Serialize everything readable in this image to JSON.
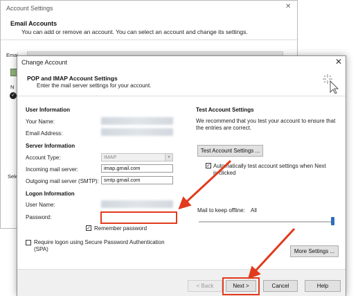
{
  "background_dialog": {
    "title": "Account Settings",
    "close": "✕",
    "heading": "Email Accounts",
    "description": "You can add or remove an account. You can select an account and change its settings.",
    "tab_label": "Emai",
    "list_letter": "N",
    "list_check": "✓",
    "side_label": "Sele"
  },
  "dialog": {
    "title": "Change Account",
    "close": "✕",
    "heading": "POP and IMAP Account Settings",
    "subheading": "Enter the mail server settings for your account."
  },
  "user_info": {
    "section": "User Information",
    "your_name_label": "Your Name:",
    "email_label": "Email Address:"
  },
  "server_info": {
    "section": "Server Information",
    "account_type_label": "Account Type:",
    "account_type_value": "IMAP",
    "incoming_label": "Incoming mail server:",
    "incoming_value": "imap.gmail.com",
    "outgoing_label": "Outgoing mail server (SMTP):",
    "outgoing_value": "smtp.gmail.com"
  },
  "logon_info": {
    "section": "Logon Information",
    "username_label": "User Name:",
    "password_label": "Password:",
    "password_value": "",
    "remember_label": "Remember password",
    "remember_checked": "✓",
    "spa_label_line1": "Require logon using Secure Password Authentication",
    "spa_label_line2": "(SPA)"
  },
  "test_settings": {
    "section": "Test Account Settings",
    "description_line1": "We recommend that you test your account to ensure that",
    "description_line2": "the entries are correct.",
    "test_button": "Test Account Settings ...",
    "auto_test_label_line1": "Automatically test account settings when Next",
    "auto_test_label_line2": "is clicked",
    "auto_test_checked": "✓"
  },
  "offline": {
    "label": "Mail to keep offline:",
    "value": "All",
    "slider_level": 1.0
  },
  "buttons": {
    "more_settings": "More Settings ...",
    "back": "< Back",
    "next": "Next >",
    "cancel": "Cancel",
    "help": "Help"
  },
  "colors": {
    "highlight_red": "#e23a1c",
    "slider_blue": "#2f6fbd"
  }
}
